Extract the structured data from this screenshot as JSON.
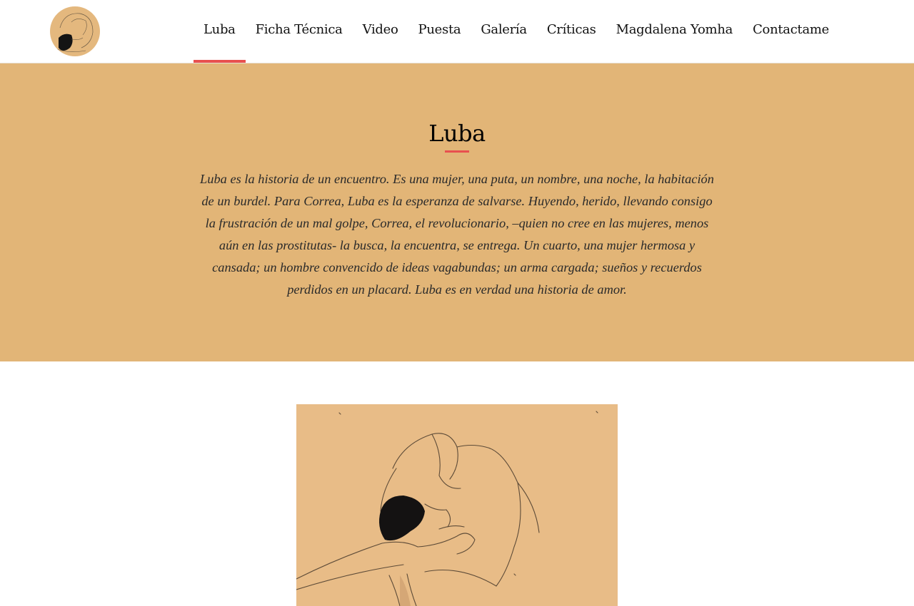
{
  "site": {
    "logo_icon": "embrace-drawing-icon"
  },
  "nav": {
    "items": [
      {
        "label": "Luba",
        "active": true
      },
      {
        "label": "Ficha Técnica"
      },
      {
        "label": "Video"
      },
      {
        "label": "Puesta"
      },
      {
        "label": "Galería"
      },
      {
        "label": "Críticas"
      },
      {
        "label": "Magdalena Yomha"
      },
      {
        "label": "Contactame"
      }
    ]
  },
  "hero": {
    "title": "Luba",
    "description": "Luba es la historia de un encuentro. Es una mujer, una puta, un nombre, una noche, la habitación de un burdel. Para Correa, Luba es la esperanza de salvarse. Huyendo, herido, llevando consigo la frustración de un mal golpe, Correa, el revolucionario, –quien no cree en las mujeres, menos aún en las prostitutas- la busca, la encuentra, se entrega. Un cuarto, una mujer hermosa y cansada; un hombre convencido de ideas vagabundas; un arma cargada; sueños y recuerdos perdidos en un placard. Luba es en verdad una historia de amor."
  },
  "artwork": {
    "icon": "embrace-drawing-icon"
  },
  "colors": {
    "accent": "#e8504f",
    "hero_background": "#e2b577",
    "paper": "#e8bc87"
  }
}
